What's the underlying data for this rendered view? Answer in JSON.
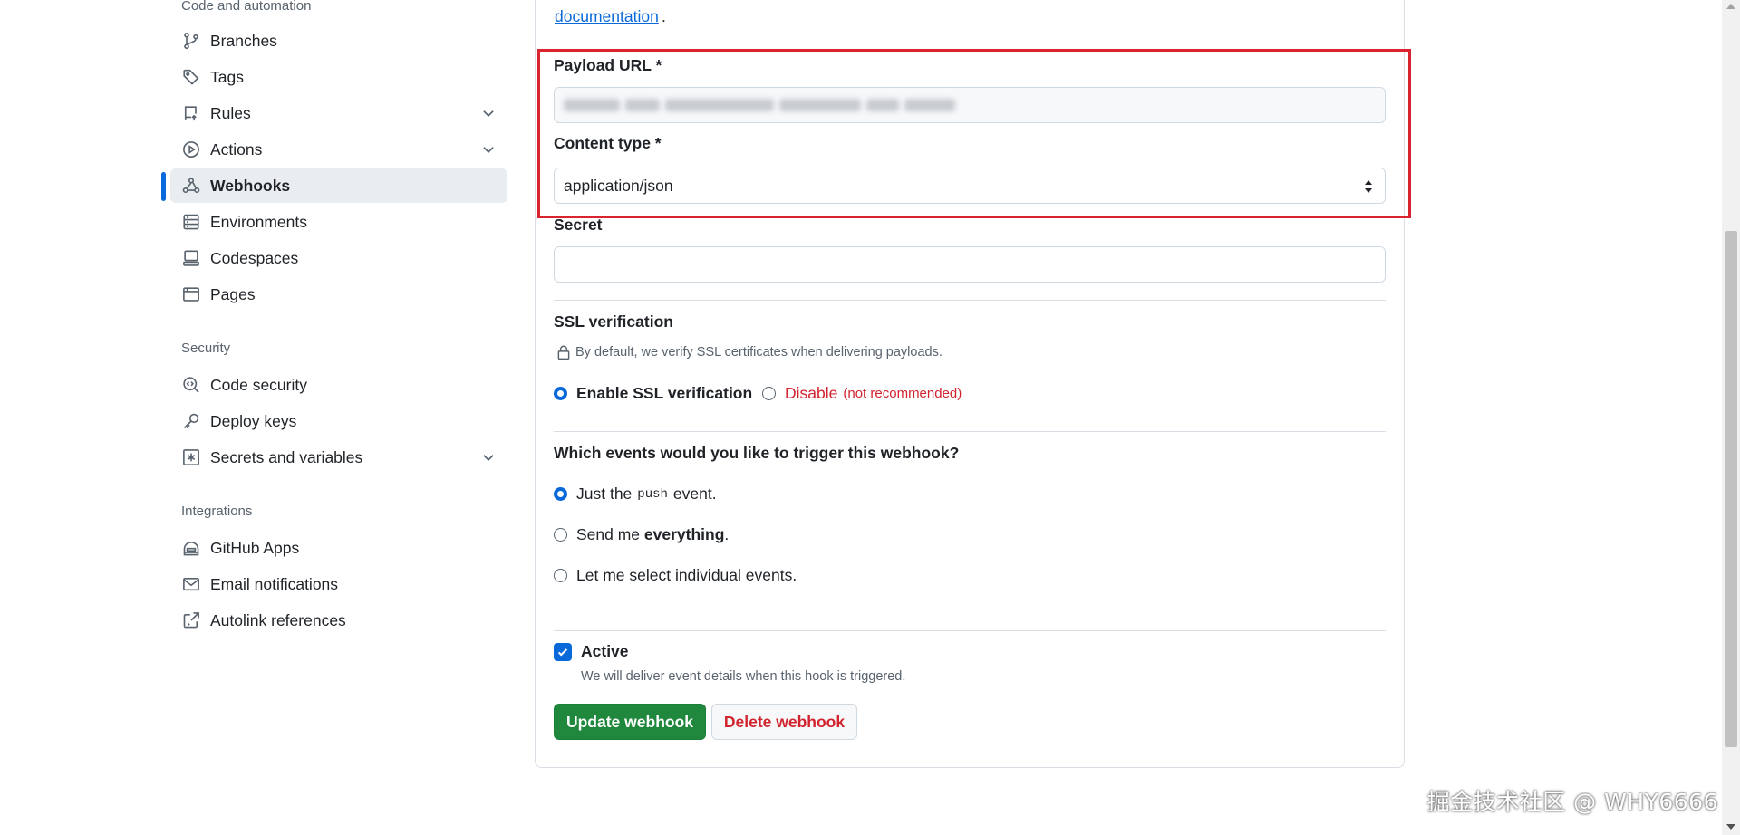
{
  "sidebar": {
    "code_heading": "Code and automation",
    "code_items": [
      {
        "label": "Branches",
        "icon": "git-branch-icon"
      },
      {
        "label": "Tags",
        "icon": "tag-icon"
      },
      {
        "label": "Rules",
        "icon": "repo-push-icon",
        "expandable": true
      },
      {
        "label": "Actions",
        "icon": "play-icon",
        "expandable": true
      },
      {
        "label": "Webhooks",
        "icon": "webhook-icon",
        "active": true
      },
      {
        "label": "Environments",
        "icon": "server-icon"
      },
      {
        "label": "Codespaces",
        "icon": "codespaces-icon"
      },
      {
        "label": "Pages",
        "icon": "browser-icon"
      }
    ],
    "security_heading": "Security",
    "security_items": [
      {
        "label": "Code security",
        "icon": "codescan-icon"
      },
      {
        "label": "Deploy keys",
        "icon": "key-icon"
      },
      {
        "label": "Secrets and variables",
        "icon": "asterisk-icon",
        "expandable": true
      }
    ],
    "integrations_heading": "Integrations",
    "integrations_items": [
      {
        "label": "GitHub Apps",
        "icon": "hubot-icon"
      },
      {
        "label": "Email notifications",
        "icon": "mail-icon"
      },
      {
        "label": "Autolink references",
        "icon": "cross-reference-icon"
      }
    ]
  },
  "form": {
    "doc_link": "documentation",
    "doc_link_suffix": ".",
    "payload_url_label": "Payload URL *",
    "content_type_label": "Content type *",
    "content_type_value": "application/json",
    "secret_label": "Secret",
    "secret_value": "",
    "ssl_heading": "SSL verification",
    "ssl_note": "By default, we verify SSL certificates when delivering payloads.",
    "ssl_enable_label": "Enable SSL verification",
    "ssl_disable_label": "Disable",
    "ssl_disable_note": "(not recommended)",
    "events_heading": "Which events would you like to trigger this webhook?",
    "event_push_prefix": "Just the",
    "event_push_code": "push",
    "event_push_suffix": "event.",
    "event_everything_prefix": "Send me",
    "event_everything_bold": "everything",
    "event_everything_suffix": ".",
    "event_individual": "Let me select individual events.",
    "selected_event": "push",
    "active_label": "Active",
    "active_checked": true,
    "active_note": "We will deliver event details when this hook is triggered.",
    "update_button": "Update webhook",
    "delete_button": "Delete webhook"
  },
  "colors": {
    "accent": "#0969da",
    "primary_button": "#1f883d",
    "danger": "#d1242f",
    "highlight_box": "#d9232e",
    "active_nav_bg": "#eaedf0"
  },
  "watermark": "掘金技术社区 @ WHY6666"
}
